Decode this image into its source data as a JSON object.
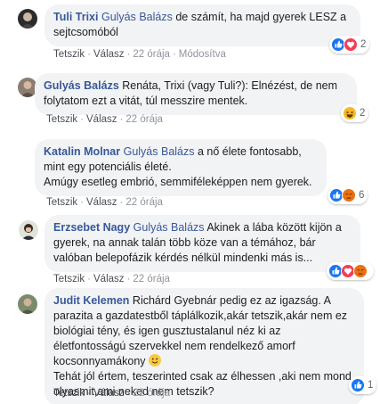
{
  "comments": [
    {
      "author": "Tuli Trixi",
      "mention": "Gulyás Balázs",
      "text": " de számít, ha majd gyerek LESZ a sejtcsomóból",
      "actions": {
        "like": "Tetszik",
        "reply": "Válasz",
        "time": "22 órája",
        "edited": "Módosítva"
      },
      "reactions": {
        "icons": [
          "like-icon",
          "love-icon"
        ],
        "count": "2"
      }
    },
    {
      "author": "Gulyás Balázs",
      "mention": "",
      "text": " Renáta, Trixi (vagy Tuli?): Elnézést, de nem folytatom ezt a vitát, túl messzire mentek.",
      "actions": {
        "like": "Tetszik",
        "reply": "Válasz",
        "time": "22 órája"
      },
      "reactions": {
        "icons": [
          "haha-icon"
        ],
        "count": "2"
      }
    },
    {
      "author": "Katalin Molnar",
      "mention": "Gulyás Balázs",
      "text": " a nő élete fontosabb, mint egy potenciális életé.",
      "text2": "Amúgy esetleg embrió, semmiféleképpen nem gyerek.",
      "actions": {
        "like": "Tetszik",
        "reply": "Válasz",
        "time": "22 órája"
      },
      "reactions": {
        "icons": [
          "like-icon",
          "angry-icon"
        ],
        "count": "6"
      }
    },
    {
      "author": "Erzsebet Nagy",
      "mention": "Gulyás Balázs",
      "text": " Akinek a lába között kijön a gyerek, na annak talán több köze van a témához, bár valóban belepofázik kérdés nélkül mindenki más is...",
      "actions": {
        "like": "Tetszik",
        "reply": "Válasz",
        "time": "22 órája"
      },
      "reactions": {
        "icons": [
          "like-icon",
          "love-icon",
          "angry-icon"
        ],
        "count": ""
      }
    },
    {
      "author": "Judit Kelemen",
      "mention": "",
      "text": " Richárd Gyebnár pedig ez az igazság. A parazita a gazdatestből táplálkozik,akár tetszik,akár nem ez biológiai tény, és igen gusztustalanul néz ki az életfontosságú szervekkel nem rendelkező amorf kocsonnyamákony",
      "text2": "Tehát jól értem, teszerinted csak az élhessen ,aki nem mond olyasmit,ami neked nem tetszik?",
      "actions": {
        "like": "Tetszik",
        "reply": "Válasz",
        "time": "22 órája"
      },
      "reactions": {
        "icons": [
          "like-icon"
        ],
        "count": "1"
      }
    }
  ],
  "colors": {
    "link": "#385898",
    "bubble": "#f2f3f5",
    "meta": "#90949c"
  }
}
